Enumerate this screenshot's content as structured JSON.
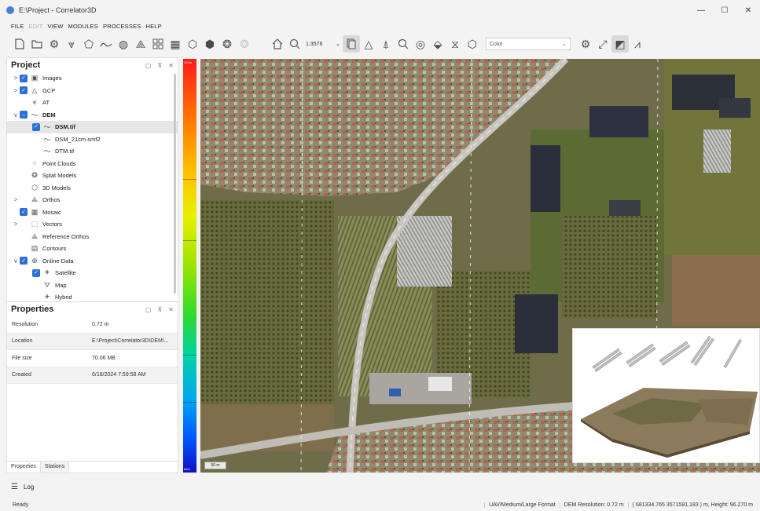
{
  "window": {
    "title": "E:\\Project - Correlator3D",
    "controls": [
      "—",
      "☐",
      "✕"
    ]
  },
  "menu": [
    "FILE",
    "EDIT",
    "VIEW",
    "MODULES",
    "PROCESSES",
    "HELP"
  ],
  "toolbar": {
    "scale": "1:3576",
    "color_mode": "Color",
    "icons": [
      "new-project-icon",
      "open-folder-icon",
      "gear-icon",
      "aerial-triangulation-icon",
      "mesh-icon",
      "dem-icon",
      "dem-edit-icon",
      "ortho-icon",
      "mosaic-icon",
      "mosaic-edit-icon",
      "3d-model-icon",
      "model-export-icon",
      "splat-icon",
      "splat-faded-icon",
      "home-icon",
      "zoom-icon",
      "layers-icon",
      "terrain-icon",
      "pin-icon",
      "zoom-point-icon",
      "view-icon",
      "height-icon",
      "hourglass-icon",
      "cube-icon",
      "settings-icon",
      "fullscreen-icon",
      "image-toggle-icon",
      "measure-icon"
    ]
  },
  "project": {
    "title": "Project",
    "items": [
      {
        "label": "Images",
        "level": 0,
        "expander": ">",
        "check": "on",
        "icon": "▣"
      },
      {
        "label": "GCP",
        "level": 0,
        "expander": ">",
        "check": "on",
        "icon": "△"
      },
      {
        "label": "AT",
        "level": 0,
        "expander": "",
        "check": "empty",
        "icon": "⩔"
      },
      {
        "label": "DEM",
        "level": 0,
        "expander": "v",
        "check": "partial",
        "icon": "〜",
        "bold": true
      },
      {
        "label": "DSM.tif",
        "level": 1,
        "expander": "",
        "check": "on",
        "icon": "〜",
        "bold": true,
        "selected": true
      },
      {
        "label": "DSM_21cm.smf2",
        "level": 1,
        "expander": "",
        "check": "empty",
        "icon": "〜"
      },
      {
        "label": "DTM.tif",
        "level": 1,
        "expander": "",
        "check": "empty",
        "icon": "〜"
      },
      {
        "label": "Point Clouds",
        "level": 0,
        "expander": "",
        "check": "empty",
        "icon": "⁘"
      },
      {
        "label": "Splat Models",
        "level": 0,
        "expander": "",
        "check": "empty",
        "icon": "❂"
      },
      {
        "label": "3D Models",
        "level": 0,
        "expander": "",
        "check": "empty",
        "icon": "⬡"
      },
      {
        "label": "Orthos",
        "level": 0,
        "expander": ">",
        "check": "empty",
        "icon": "⟁"
      },
      {
        "label": "Mosaic",
        "level": 0,
        "expander": "",
        "check": "on",
        "icon": "▦"
      },
      {
        "label": "Vectors",
        "level": 0,
        "expander": ">",
        "check": "empty",
        "icon": "⬚"
      },
      {
        "label": "Reference Orthos",
        "level": 0,
        "expander": "",
        "check": "empty",
        "icon": "⟁"
      },
      {
        "label": "Contours",
        "level": 0,
        "expander": "",
        "check": "empty",
        "icon": "▤"
      },
      {
        "label": "Online Data",
        "level": 0,
        "expander": "v",
        "check": "on",
        "icon": "⊕"
      },
      {
        "label": "Satellite",
        "level": 1,
        "expander": "",
        "check": "on",
        "icon": "✈"
      },
      {
        "label": "Map",
        "level": 1,
        "expander": "",
        "check": "empty",
        "icon": "⛛"
      },
      {
        "label": "Hybrid",
        "level": 1,
        "expander": "",
        "check": "empty",
        "icon": "✈"
      }
    ]
  },
  "properties": {
    "title": "Properties",
    "rows": [
      {
        "key": "Resolution",
        "value": "0.72 m"
      },
      {
        "key": "Location",
        "value": "E:\\Project\\Correlator3D\\DEM\\..."
      },
      {
        "key": "File size",
        "value": "70.06 MB"
      },
      {
        "key": "Created",
        "value": "6/18/2024 7:59:58 AM"
      }
    ]
  },
  "bottom_tabs": [
    "Properties",
    "Stations"
  ],
  "ramp": {
    "top_label": "104m",
    "bottom_label": "62m"
  },
  "map": {
    "scale_bar": "50 m"
  },
  "log": {
    "label": "Log"
  },
  "status": {
    "left": "Ready",
    "items": [
      "UAV/Medium/Large Format",
      "DEM Resolution: 0.72 m",
      "( 681334.765 3571591.183 ) m, Height: 96.270 m"
    ]
  }
}
